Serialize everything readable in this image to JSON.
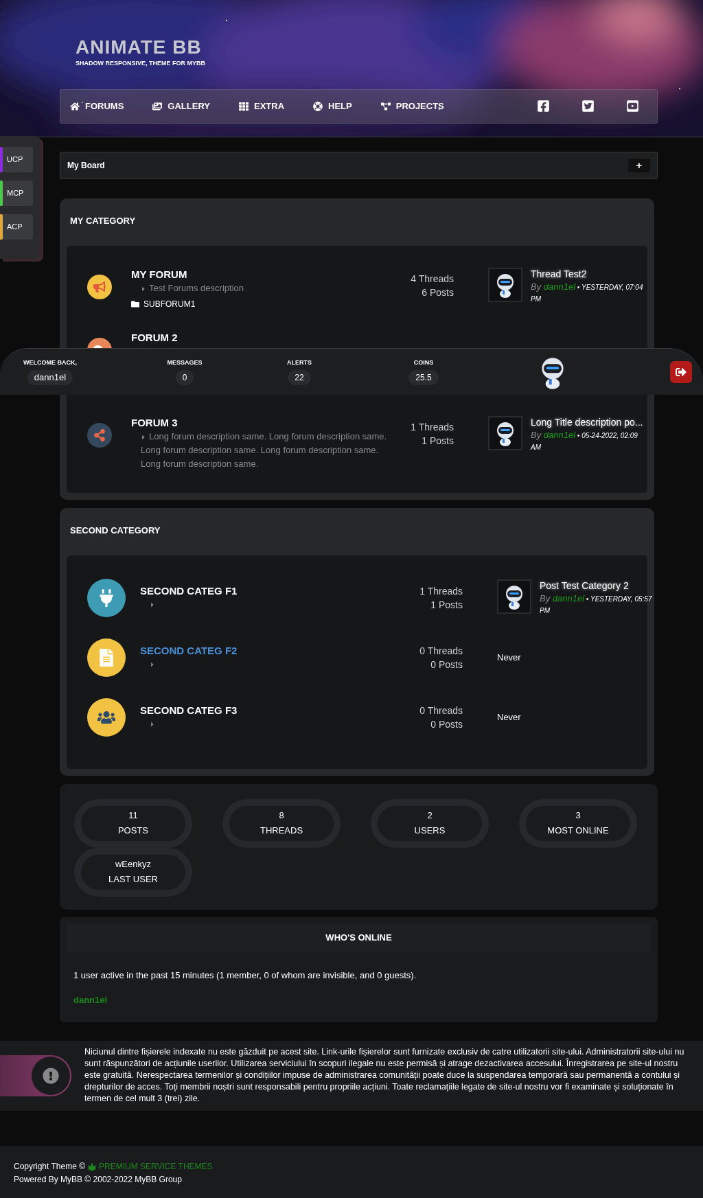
{
  "header": {
    "title": "ANIMATE BB",
    "subtitle": "SHADOW RESPONSIVE, THEME FOR MYBB"
  },
  "nav": {
    "items": [
      {
        "label": "FORUMS"
      },
      {
        "label": "GALLERY"
      },
      {
        "label": "EXTRA"
      },
      {
        "label": "HELP"
      },
      {
        "label": "PROJECTS"
      }
    ]
  },
  "side_panel": {
    "items": [
      {
        "label": "UCP",
        "color": "#8a2be2"
      },
      {
        "label": "MCP",
        "color": "#4cc94c"
      },
      {
        "label": "ACP",
        "color": "#e0a83a"
      }
    ]
  },
  "breadcrumb": {
    "label": "My Board",
    "button": "+"
  },
  "categories": [
    {
      "title": "MY CATEGORY",
      "forums": [
        {
          "name": "MY FORUM",
          "highlighted": false,
          "description": "Test Forums description",
          "subforums": [
            "SUBFORUM1"
          ],
          "threads": "4 Threads",
          "posts": "6 Posts",
          "last_post": {
            "kind": "post",
            "title": "Thread Test2",
            "by": "By",
            "author": "dann1el",
            "date": "• YESTERDAY, 07:04 PM"
          }
        },
        {
          "name": "FORUM 2",
          "highlighted": false
        },
        {
          "name": "FORUM 3",
          "highlighted": false,
          "description": "Long forum description same. Long forum description same. Long forum description same. Long forum description same. Long forum description same.",
          "threads": "1 Threads",
          "posts": "1 Posts",
          "last_post": {
            "kind": "post",
            "title": "Long Title description po...",
            "by": "By",
            "author": "dann1el",
            "date": "• 05-24-2022, 02:09 AM"
          }
        }
      ]
    },
    {
      "title": "SECOND CATEGORY",
      "forums": [
        {
          "name": "SECOND CATEG F1",
          "highlighted": false,
          "threads": "1 Threads",
          "posts": "1 Posts",
          "last_post": {
            "kind": "post",
            "title": "Post Test Category 2",
            "by": "By",
            "author": "dann1el",
            "date": "• YESTERDAY, 05:57 PM"
          }
        },
        {
          "name": "SECOND CATEG F2",
          "highlighted": true,
          "threads": "0 Threads",
          "posts": "0 Posts",
          "last_post": {
            "kind": "never",
            "text": "Never"
          }
        },
        {
          "name": "SECOND CATEG F3",
          "highlighted": false,
          "threads": "0 Threads",
          "posts": "0 Posts",
          "last_post": {
            "kind": "never",
            "text": "Never"
          }
        }
      ]
    }
  ],
  "user_bar": {
    "welcome": "WELCOME BACK,",
    "username": "dann1el",
    "stats": [
      {
        "label": "MESSAGES",
        "value": "0"
      },
      {
        "label": "ALERTS",
        "value": "22"
      },
      {
        "label": "COINS",
        "value": "25.5"
      }
    ]
  },
  "board_stats": [
    {
      "value": "11",
      "label": "POSTS"
    },
    {
      "value": "8",
      "label": "THREADS"
    },
    {
      "value": "2",
      "label": "USERS"
    },
    {
      "value": "3",
      "label": "MOST ONLINE"
    },
    {
      "value": "wEenkyz",
      "label": "LAST USER"
    }
  ],
  "whos_online": {
    "title": "WHO'S ONLINE",
    "text": "1 user active in the past 15 minutes (1 member, 0 of whom are invisible, and 0 guests).",
    "users": [
      "dann1el"
    ]
  },
  "disclaimer": "Niciunul dintre fișierele indexate nu este găzduit pe acest site. Link-urile fișierelor sunt furnizate exclusiv de catre utilizatorii site-ului. Administratorii site-ului nu sunt răspunzători de acțiunile userilor. Utilizarea serviciului în scopuri ilegale nu este permisă și atrage dezactivarea accesului. Înregistrarea pe site-ul nostru este gratuită. Nerespectarea termenilor și condițiilor impuse de administrarea comunității poate duce la suspendarea temporară sau permanentă a contului și drepturilor de acces. Toți membrii noștri sunt responsabili pentru propriile acțiuni. Toate reclamațiile legate de site-ul nostru vor fi examinate și soluționate în termen de cel mult 3 (trei) zile.",
  "footer": {
    "copyright": "Copyright Theme ©",
    "link": "PREMIUM SERVICE THEMES",
    "powered": "Powered By MyBB © 2002-2022 MyBB Group"
  }
}
